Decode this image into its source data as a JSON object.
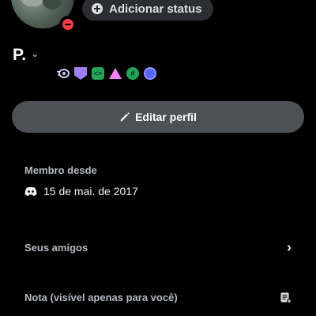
{
  "profile": {
    "avatar_icon": "avatar",
    "status_indicator": "do-not-disturb",
    "status_color": "#f23f43",
    "add_status_label": "Adicionar status",
    "username": "P.",
    "badges": [
      "nitro-badge",
      "boost-badge",
      "developer-badge",
      "hypesquad-badge",
      "hashtag-badge",
      "moderator-badge"
    ]
  },
  "actions": {
    "edit_profile_label": "Editar perfil"
  },
  "member": {
    "label": "Membro desde",
    "date": "15 de mai. de 2017"
  },
  "friends": {
    "label": "Seus amigos"
  },
  "note": {
    "label": "Nota (visível apenas para você)"
  },
  "colors": {
    "background": "#000000",
    "button": "#4e5058",
    "status_pill": "#2b2d31"
  }
}
